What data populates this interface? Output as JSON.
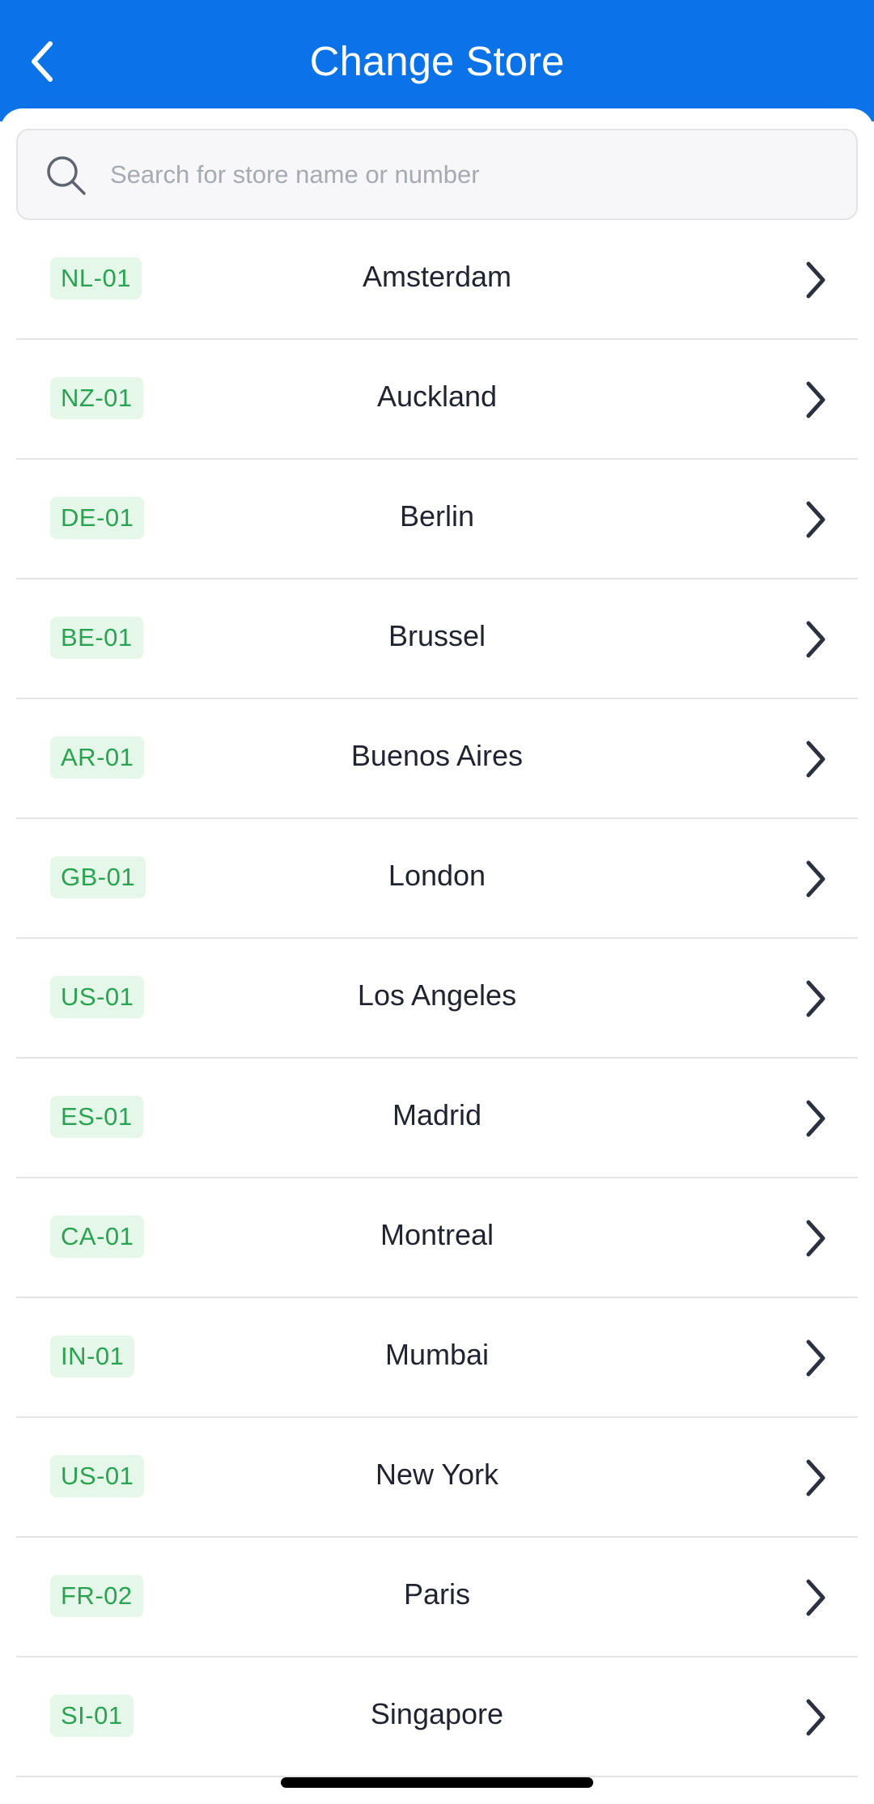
{
  "header": {
    "title": "Change Store",
    "background": "#0b72e7"
  },
  "search": {
    "placeholder": "Search for store name or number"
  },
  "stores": [
    {
      "code": "NL-01",
      "name": "Amsterdam"
    },
    {
      "code": "NZ-01",
      "name": "Auckland"
    },
    {
      "code": "DE-01",
      "name": "Berlin"
    },
    {
      "code": "BE-01",
      "name": "Brussel"
    },
    {
      "code": "AR-01",
      "name": "Buenos Aires"
    },
    {
      "code": "GB-01",
      "name": "London"
    },
    {
      "code": "US-01",
      "name": "Los Angeles"
    },
    {
      "code": "ES-01",
      "name": "Madrid"
    },
    {
      "code": "CA-01",
      "name": "Montreal"
    },
    {
      "code": "IN-01",
      "name": "Mumbai"
    },
    {
      "code": "US-01",
      "name": "New York"
    },
    {
      "code": "FR-02",
      "name": "Paris"
    },
    {
      "code": "SI-01",
      "name": "Singapore"
    }
  ],
  "colors": {
    "badge_bg": "#e5f7e9",
    "badge_text": "#2aa351",
    "divider": "#e2e4e8"
  }
}
